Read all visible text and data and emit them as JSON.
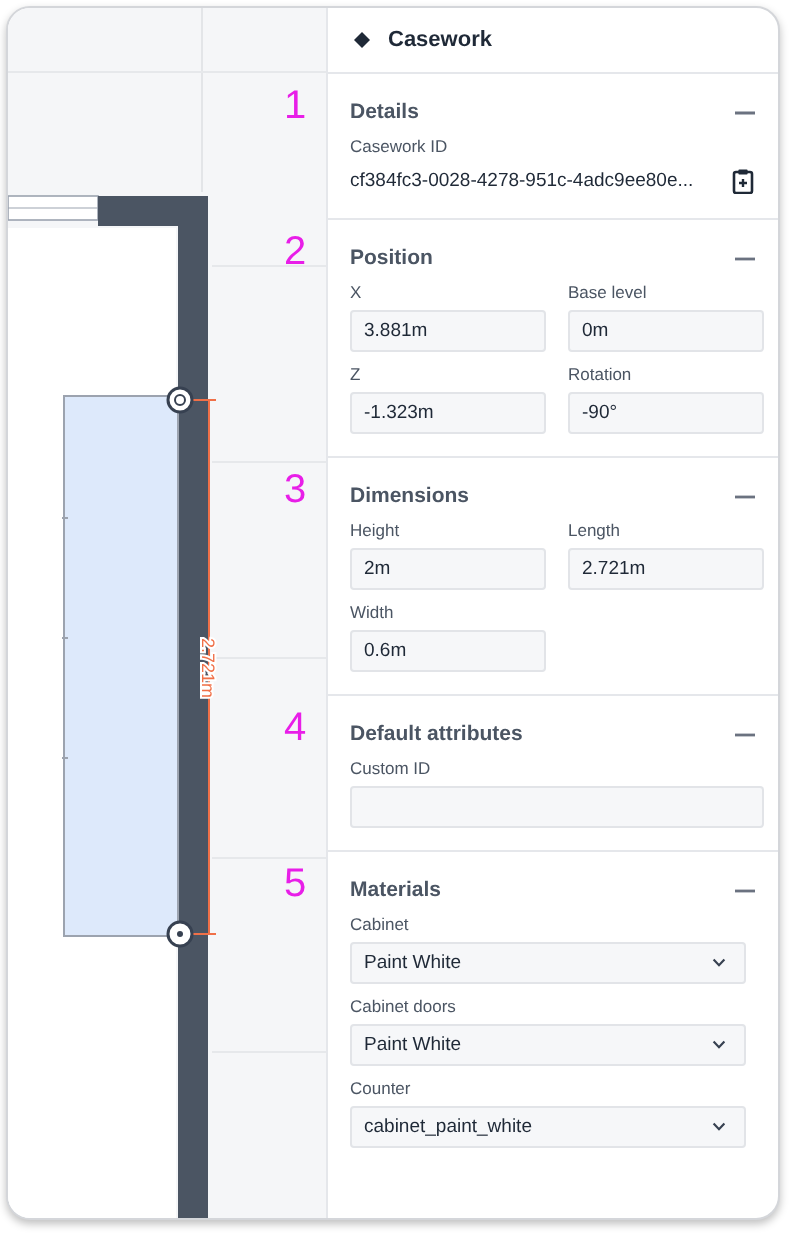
{
  "canvas": {
    "dimension_label": "2.721m"
  },
  "panel": {
    "title": "Casework",
    "sections": [
      {
        "marker": "1",
        "title": "Details",
        "expanded": true,
        "fields": [
          {
            "kind": "readonly",
            "label": "Casework ID",
            "value": "cf384fc3-0028-4278-951c-4adc9ee80e..."
          }
        ]
      },
      {
        "marker": "2",
        "title": "Position",
        "expanded": true,
        "fields": [
          {
            "kind": "text",
            "label": "X",
            "value": "3.881m"
          },
          {
            "kind": "text",
            "label": "Base level",
            "value": "0m"
          },
          {
            "kind": "text",
            "label": "Z",
            "value": "-1.323m"
          },
          {
            "kind": "text",
            "label": "Rotation",
            "value": "-90°"
          }
        ]
      },
      {
        "marker": "3",
        "title": "Dimensions",
        "expanded": true,
        "fields": [
          {
            "kind": "text",
            "label": "Height",
            "value": "2m"
          },
          {
            "kind": "text",
            "label": "Length",
            "value": "2.721m"
          },
          {
            "kind": "text",
            "label": "Width",
            "value": "0.6m"
          }
        ]
      },
      {
        "marker": "4",
        "title": "Default attributes",
        "expanded": true,
        "fields": [
          {
            "kind": "wide",
            "label": "Custom ID"
          }
        ]
      },
      {
        "marker": "5",
        "title": "Materials",
        "expanded": true,
        "fields": [
          {
            "kind": "select",
            "label": "Cabinet",
            "value": "Paint White"
          },
          {
            "kind": "select",
            "label": "Cabinet doors",
            "value": "Paint White"
          },
          {
            "kind": "select",
            "label": "Counter",
            "value": "cabinet_paint_white"
          }
        ]
      }
    ]
  }
}
